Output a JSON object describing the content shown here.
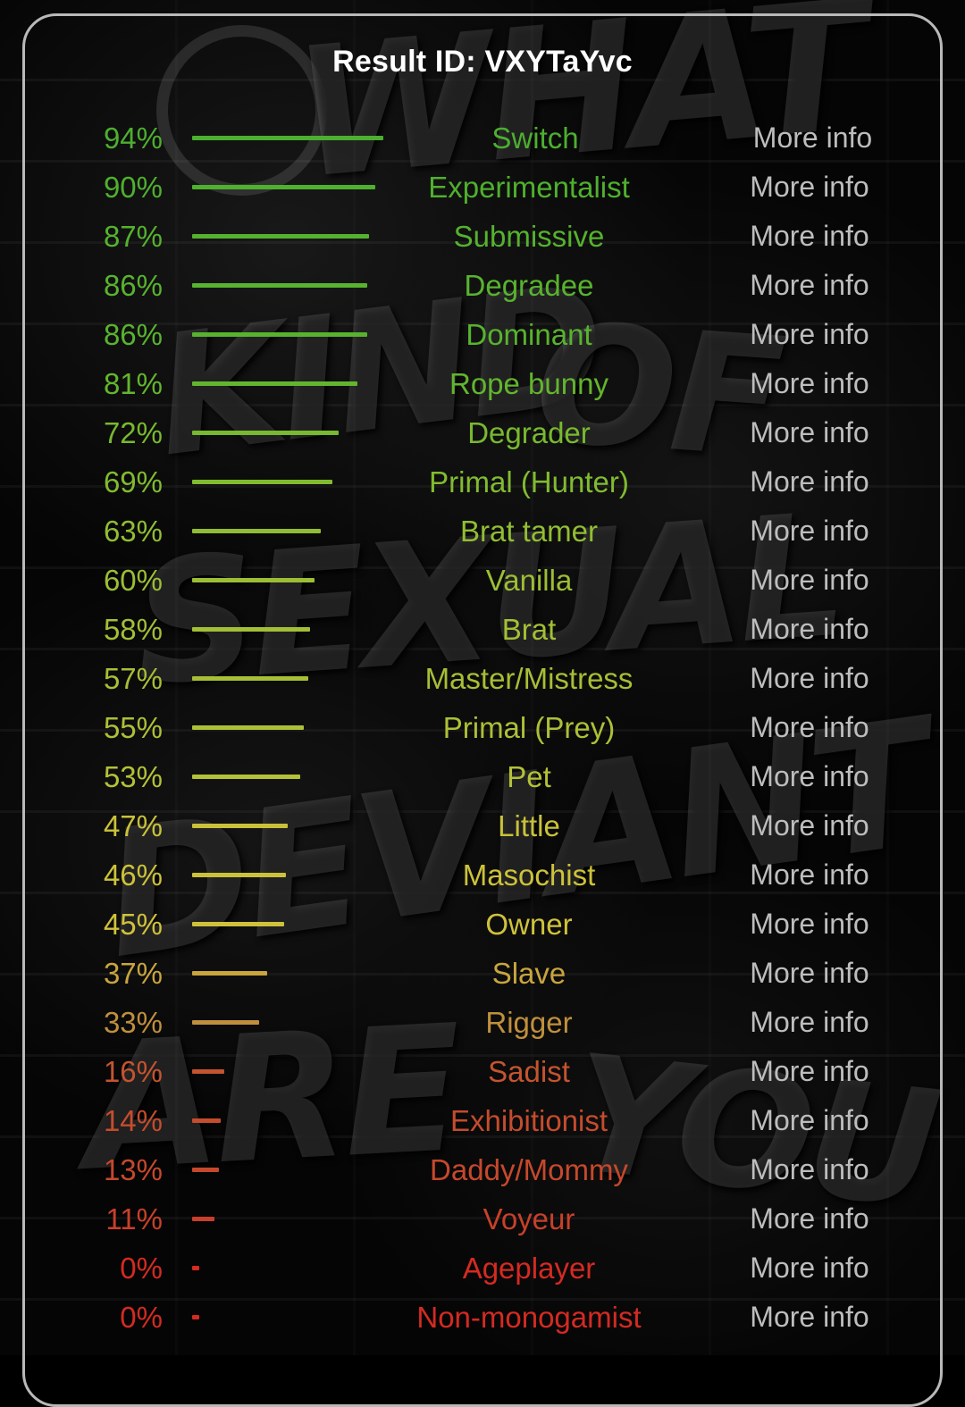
{
  "title": "Result ID: VXYTaYvc",
  "more_info_label": "More info",
  "background": {
    "graffiti_words": [
      "WHAT",
      "KIND",
      "OF",
      "SEXUAL",
      "DEVIANT",
      "ARE",
      "YOU"
    ]
  },
  "colors": {
    "title": "#ffffff",
    "border": "#b9b9b9",
    "more_info": "#bdbdbd",
    "background": "#050505"
  },
  "chart_data": {
    "type": "bar",
    "title": "Result ID: VXYTaYvc",
    "xlabel": "",
    "ylabel": "",
    "xlim": [
      0,
      100
    ],
    "grid": false,
    "legend": false,
    "orientation": "horizontal",
    "categories": [
      "Switch",
      "Experimentalist",
      "Submissive",
      "Degradee",
      "Dominant",
      "Rope bunny",
      "Degrader",
      "Primal (Hunter)",
      "Brat tamer",
      "Vanilla",
      "Brat",
      "Master/Mistress",
      "Primal (Prey)",
      "Pet",
      "Little",
      "Masochist",
      "Owner",
      "Slave",
      "Rigger",
      "Sadist",
      "Exhibitionist",
      "Daddy/Mommy",
      "Voyeur",
      "Ageplayer",
      "Non-monogamist"
    ],
    "values": [
      94,
      90,
      87,
      86,
      86,
      81,
      72,
      69,
      63,
      60,
      58,
      57,
      55,
      53,
      47,
      46,
      45,
      37,
      33,
      16,
      14,
      13,
      11,
      0,
      0
    ]
  },
  "rows": [
    {
      "percent": "94%",
      "value": 94,
      "label": "Switch",
      "color": "#4caf30",
      "more": "More info"
    },
    {
      "percent": "90%",
      "value": 90,
      "label": "Experimentalist",
      "color": "#4fb02e",
      "more": "More info"
    },
    {
      "percent": "87%",
      "value": 87,
      "label": "Submissive",
      "color": "#55b22e",
      "more": "More info"
    },
    {
      "percent": "86%",
      "value": 86,
      "label": "Degradee",
      "color": "#58b32e",
      "more": "More info"
    },
    {
      "percent": "86%",
      "value": 86,
      "label": "Dominant",
      "color": "#58b32e",
      "more": "More info"
    },
    {
      "percent": "81%",
      "value": 81,
      "label": "Rope bunny",
      "color": "#63b52e",
      "more": "More info"
    },
    {
      "percent": "72%",
      "value": 72,
      "label": "Degrader",
      "color": "#78b92f",
      "more": "More info"
    },
    {
      "percent": "69%",
      "value": 69,
      "label": "Primal (Hunter)",
      "color": "#81bb30",
      "more": "More info"
    },
    {
      "percent": "63%",
      "value": 63,
      "label": "Brat tamer",
      "color": "#92bd33",
      "more": "More info"
    },
    {
      "percent": "60%",
      "value": 60,
      "label": "Vanilla",
      "color": "#9cbe34",
      "more": "More info"
    },
    {
      "percent": "58%",
      "value": 58,
      "label": "Brat",
      "color": "#a3bf35",
      "more": "More info"
    },
    {
      "percent": "57%",
      "value": 57,
      "label": "Master/Mistress",
      "color": "#a6bf35",
      "more": "More info"
    },
    {
      "percent": "55%",
      "value": 55,
      "label": "Primal (Prey)",
      "color": "#adc036",
      "more": "More info"
    },
    {
      "percent": "53%",
      "value": 53,
      "label": "Pet",
      "color": "#b4c137",
      "more": "More info"
    },
    {
      "percent": "47%",
      "value": 47,
      "label": "Little",
      "color": "#c8c23a",
      "more": "More info"
    },
    {
      "percent": "46%",
      "value": 46,
      "label": "Masochist",
      "color": "#ccc23a",
      "more": "More info"
    },
    {
      "percent": "45%",
      "value": 45,
      "label": "Owner",
      "color": "#cfc23b",
      "more": "More info"
    },
    {
      "percent": "37%",
      "value": 37,
      "label": "Slave",
      "color": "#c9a53e",
      "more": "More info"
    },
    {
      "percent": "33%",
      "value": 33,
      "label": "Rigger",
      "color": "#c08f3d",
      "more": "More info"
    },
    {
      "percent": "16%",
      "value": 16,
      "label": "Sadist",
      "color": "#c4542f",
      "more": "More info"
    },
    {
      "percent": "14%",
      "value": 14,
      "label": "Exhibitionist",
      "color": "#c54c2d",
      "more": "More info"
    },
    {
      "percent": "13%",
      "value": 13,
      "label": "Daddy/Mommy",
      "color": "#c6482c",
      "more": "More info"
    },
    {
      "percent": "11%",
      "value": 11,
      "label": "Voyeur",
      "color": "#c8402a",
      "more": "More info"
    },
    {
      "percent": "0%",
      "value": 0,
      "label": "Ageplayer",
      "color": "#d42a22",
      "more": "More info"
    },
    {
      "percent": "0%",
      "value": 0,
      "label": "Non-monogamist",
      "color": "#d42a22",
      "more": "More info"
    }
  ]
}
